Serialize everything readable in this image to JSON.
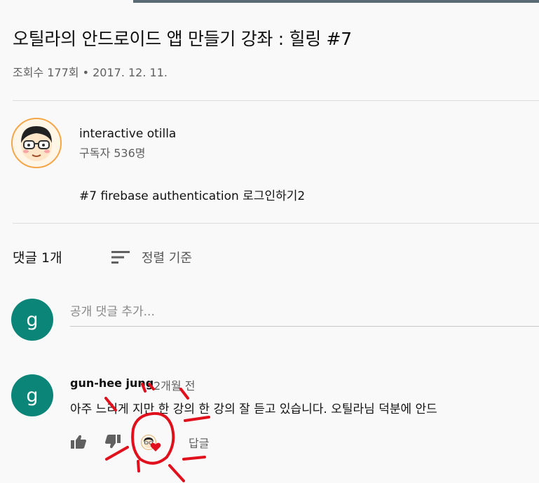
{
  "video": {
    "title": "오틸라의 안드로이드 앱 만들기 강좌 : 힐링 #7",
    "meta": "조회수 177회 • 2017. 12. 11."
  },
  "channel": {
    "avatar_icon": "cartoon-face-avatar",
    "name": "interactive otilla",
    "subscribers": "구독자 536명",
    "description": "#7 firebase authentication 로그인하기2"
  },
  "comments": {
    "count_label": "댓글 1개",
    "sort_icon": "sort-icon",
    "sort_label": "정렬 기준",
    "input_avatar_letter": "g",
    "input_placeholder": "공개 댓글 추가...",
    "items": [
      {
        "avatar_letter": "g",
        "author": "gun-hee jung",
        "time": "2개월 전",
        "text": "아주 느리게 지만 한 강의 한 강의 잘 듣고 있습니다.  오틸라님 덕분에 안드",
        "like_icon": "thumbs-up-icon",
        "dislike_icon": "thumbs-down-icon",
        "creator_heart_icon": "creator-heart-icon",
        "reply_label": "답글"
      }
    ]
  },
  "colors": {
    "avatar_green": "#0a8578",
    "heart_red": "#e0101c",
    "annotation_red": "#e0101c",
    "secondary_text": "#606060"
  }
}
